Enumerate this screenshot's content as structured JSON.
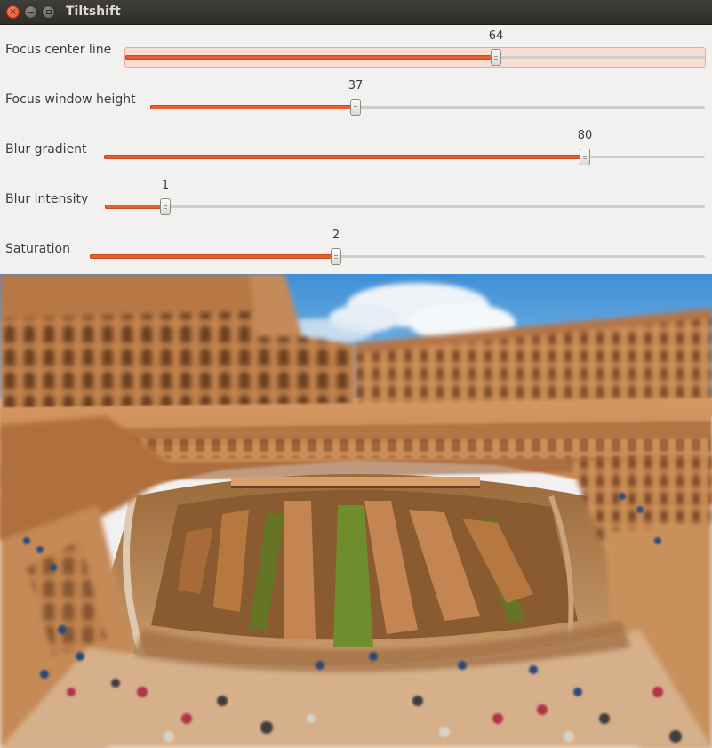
{
  "window": {
    "title": "Tiltshift",
    "close_glyph": "×"
  },
  "sliders": [
    {
      "label": "Focus center line",
      "value": "64",
      "level": 0.64,
      "focused": true
    },
    {
      "label": "Focus window height",
      "value": "37",
      "level": 0.37,
      "focused": false
    },
    {
      "label": "Blur gradient",
      "value": "80",
      "level": 0.8,
      "focused": false
    },
    {
      "label": "Blur intensity",
      "value": "1",
      "level": 0.1,
      "focused": false
    },
    {
      "label": "Saturation",
      "value": "2",
      "level": 0.4,
      "focused": false
    }
  ],
  "preview": {
    "subject": "tilt-shift colosseum photo",
    "colors": {
      "sky": "#5aa4dc",
      "cloud": "#eef3f8",
      "stone": "#c98a52",
      "stone_dark": "#8e5530",
      "arena_floor": "#a8753f",
      "grass": "#6f8d2c",
      "accent": "#e8602d"
    }
  }
}
